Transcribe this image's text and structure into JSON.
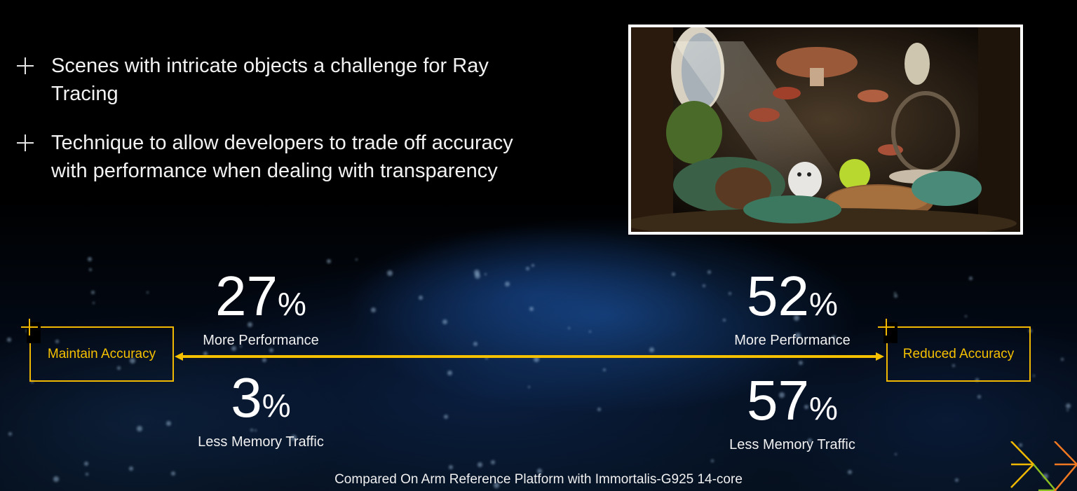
{
  "bullets": [
    {
      "icon": "cross-bullet-icon",
      "text": "Scenes with intricate objects a challenge for Ray Tracing"
    },
    {
      "icon": "cross-bullet-icon",
      "text": "Technique to allow developers to trade off accuracy with performance when dealing with transparency"
    }
  ],
  "image": {
    "description": "Ray-traced forest scene with mushrooms, a white squirrel and a tennis ball"
  },
  "scale": {
    "left_label": "Maintain Accuracy",
    "right_label": "Reduced Accuracy",
    "accent_color": "#f5c000"
  },
  "stats": {
    "left_perf": {
      "value": "27",
      "unit": "%",
      "label": "More Performance"
    },
    "left_mem": {
      "value": "3",
      "unit": "%",
      "label": "Less Memory Traffic"
    },
    "right_perf": {
      "value": "52",
      "unit": "%",
      "label": "More Performance"
    },
    "right_mem": {
      "value": "57",
      "unit": "%",
      "label": "Less Memory Traffic"
    }
  },
  "footnote": "Compared On Arm Reference Platform with Immortalis-G925 14-core",
  "logo": {
    "icon": "arm-chevrons-logo-icon",
    "colors": [
      "#f0b800",
      "#f07820",
      "#8cc020"
    ]
  }
}
